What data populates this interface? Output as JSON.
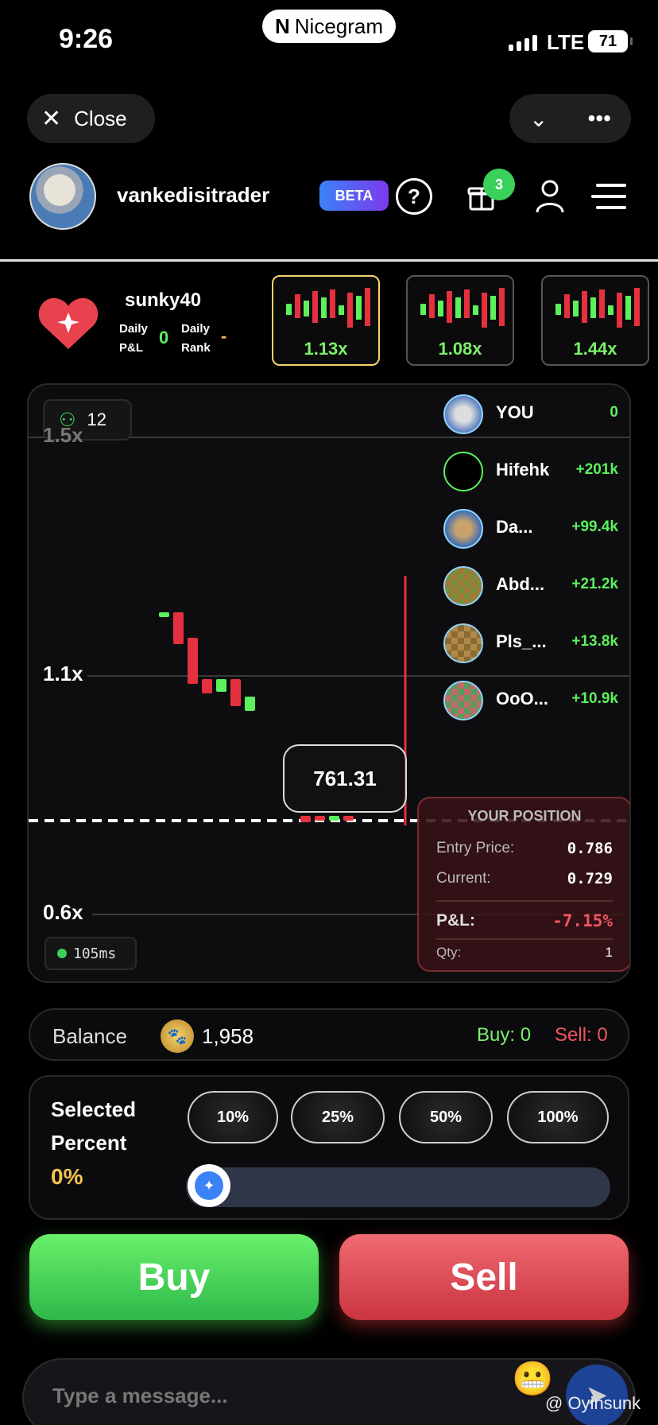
{
  "status": {
    "time": "9:26",
    "app_name": "Nicegram",
    "network": "LTE",
    "battery": "71"
  },
  "nav": {
    "close_label": "Close"
  },
  "header": {
    "username": "vankedisitrader",
    "beta_label": "BETA",
    "gift_count": "3"
  },
  "stats": {
    "name": "sunky40",
    "pnl_label_1": "Daily",
    "pnl_label_2": "P&L",
    "pnl_value": "0",
    "rank_label_1": "Daily",
    "rank_label_2": "Rank",
    "rank_value": "-"
  },
  "multipliers": [
    {
      "label": "1.13x",
      "active": true
    },
    {
      "label": "1.08x",
      "active": false
    },
    {
      "label": "1.44x",
      "active": false
    }
  ],
  "chart": {
    "viewers": "12",
    "y_labels": [
      "1.5x",
      "1.1x",
      "0.6x"
    ],
    "current_price": "761.31",
    "latency": "105ms"
  },
  "leaderboard": [
    {
      "name": "YOU",
      "value": "0"
    },
    {
      "name": "Hifehk",
      "value": "+201k"
    },
    {
      "name": "Da...",
      "value": "+99.4k"
    },
    {
      "name": "Abd...",
      "value": "+21.2k"
    },
    {
      "name": "Pls_...",
      "value": "+13.8k"
    },
    {
      "name": "OoO...",
      "value": "+10.9k"
    }
  ],
  "position": {
    "title": "YOUR POSITION",
    "entry_label": "Entry Price:",
    "entry_value": "0.786",
    "current_label": "Current:",
    "current_value": "0.729",
    "pnl_label": "P&L:",
    "pnl_value": "-7.15%",
    "qty_label": "Qty:",
    "qty_value": "1"
  },
  "balance": {
    "label": "Balance",
    "value": "1,958",
    "buy": "Buy: 0",
    "sell": "Sell: 0"
  },
  "percent": {
    "title_1": "Selected",
    "title_2": "Percent",
    "value": "0%",
    "options": [
      "10%",
      "25%",
      "50%",
      "100%"
    ],
    "slider_fraction": 0
  },
  "actions": {
    "buy": "Buy",
    "sell": "Sell"
  },
  "message": {
    "placeholder": "Type a message..."
  },
  "watermark": "@ Oyinsunk",
  "colors": {
    "up": "#5cf05c",
    "down": "#e53040",
    "accent": "#3b82f6",
    "gold": "#f5c451"
  }
}
